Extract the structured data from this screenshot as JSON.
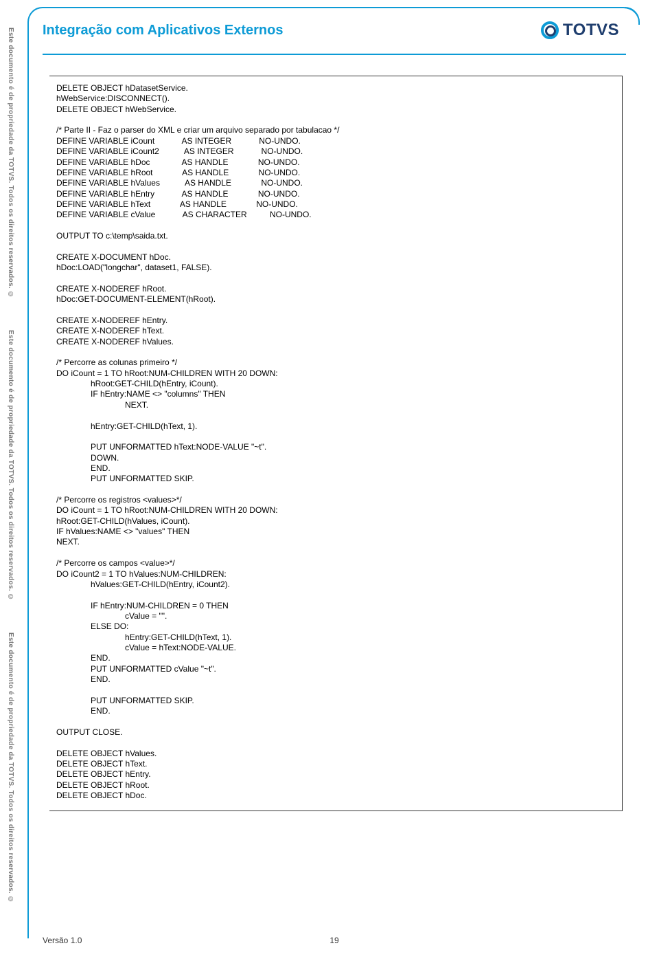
{
  "side_text": "Este documento é de propriedade da TOTVS. Todos os direitos reservados. ©",
  "header": {
    "title": "Integração com Aplicativos Externos",
    "brand": "TOTVS"
  },
  "code": "DELETE OBJECT hDatasetService.\nhWebService:DISCONNECT().\nDELETE OBJECT hWebService.\n\n/* Parte II - Faz o parser do XML e criar um arquivo separado por tabulacao */\nDEFINE VARIABLE iCount            AS INTEGER            NO-UNDO.\nDEFINE VARIABLE iCount2           AS INTEGER            NO-UNDO.\nDEFINE VARIABLE hDoc              AS HANDLE             NO-UNDO.\nDEFINE VARIABLE hRoot             AS HANDLE             NO-UNDO.\nDEFINE VARIABLE hValues           AS HANDLE             NO-UNDO.\nDEFINE VARIABLE hEntry            AS HANDLE             NO-UNDO.\nDEFINE VARIABLE hText             AS HANDLE             NO-UNDO.\nDEFINE VARIABLE cValue            AS CHARACTER          NO-UNDO.\n\nOUTPUT TO c:\\temp\\saida.txt.\n\nCREATE X-DOCUMENT hDoc.\nhDoc:LOAD(\"longchar\", dataset1, FALSE).\n\nCREATE X-NODEREF hRoot.\nhDoc:GET-DOCUMENT-ELEMENT(hRoot).\n\nCREATE X-NODEREF hEntry.\nCREATE X-NODEREF hText.\nCREATE X-NODEREF hValues.\n\n/* Percorre as colunas primeiro */\nDO iCount = 1 TO hRoot:NUM-CHILDREN WITH 20 DOWN:\n               hRoot:GET-CHILD(hEntry, iCount).\n               IF hEntry:NAME <> \"columns\" THEN\n                              NEXT.\n\n               hEntry:GET-CHILD(hText, 1).\n\n               PUT UNFORMATTED hText:NODE-VALUE \"~t\".\n               DOWN.\n               END.\n               PUT UNFORMATTED SKIP.\n\n/* Percorre os registros <values>*/\nDO iCount = 1 TO hRoot:NUM-CHILDREN WITH 20 DOWN:\nhRoot:GET-CHILD(hValues, iCount).\nIF hValues:NAME <> \"values\" THEN\nNEXT.\n\n/* Percorre os campos <value>*/\nDO iCount2 = 1 TO hValues:NUM-CHILDREN:\n               hValues:GET-CHILD(hEntry, iCount2).\n\n               IF hEntry:NUM-CHILDREN = 0 THEN\n                              cValue = \"\".\n               ELSE DO:\n                              hEntry:GET-CHILD(hText, 1).\n                              cValue = hText:NODE-VALUE.\n               END.\n               PUT UNFORMATTED cValue \"~t\".\n               END.\n\n               PUT UNFORMATTED SKIP.\n               END.\n\nOUTPUT CLOSE.\n\nDELETE OBJECT hValues.\nDELETE OBJECT hText.\nDELETE OBJECT hEntry.\nDELETE OBJECT hRoot.\nDELETE OBJECT hDoc.",
  "footer": {
    "version": "Versão 1.0",
    "page": "19"
  }
}
